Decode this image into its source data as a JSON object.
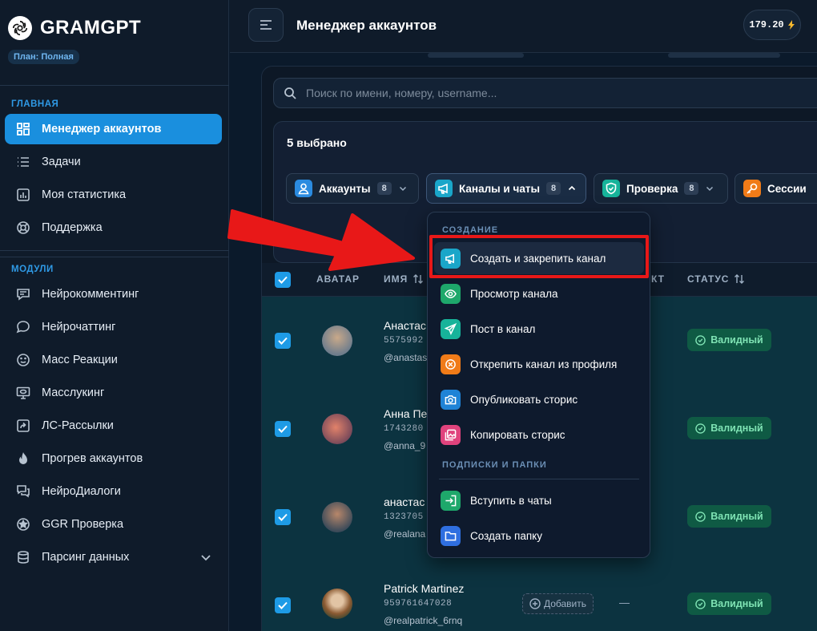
{
  "brand": {
    "name": "GRAMGPT",
    "plan": "План: Полная"
  },
  "sidebar": {
    "section_main": "ГЛАВНАЯ",
    "section_modules": "МОДУЛИ",
    "main_items": [
      {
        "label": "Менеджер аккаунтов",
        "icon": "grid-icon",
        "active": true
      },
      {
        "label": "Задачи",
        "icon": "list-icon"
      },
      {
        "label": "Моя статистика",
        "icon": "chart-icon"
      },
      {
        "label": "Поддержка",
        "icon": "lifebuoy-icon"
      }
    ],
    "module_items": [
      {
        "label": "Нейрокомментинг",
        "icon": "comment-icon"
      },
      {
        "label": "Нейрочаттинг",
        "icon": "chat-bubble-icon"
      },
      {
        "label": "Масс Реакции",
        "icon": "smile-icon"
      },
      {
        "label": "Масслукинг",
        "icon": "monitor-eye-icon"
      },
      {
        "label": "ЛС-Рассылки",
        "icon": "forward-icon"
      },
      {
        "label": "Прогрев аккаунтов",
        "icon": "flame-icon"
      },
      {
        "label": "НейроДиалоги",
        "icon": "dialogs-icon"
      },
      {
        "label": "GGR Проверка",
        "icon": "star-badge-icon"
      },
      {
        "label": "Парсинг данных",
        "icon": "database-icon"
      }
    ]
  },
  "header": {
    "title": "Менеджер аккаунтов",
    "balance": "179.20"
  },
  "search": {
    "placeholder": "Поиск по имени, номеру, username..."
  },
  "selection": {
    "count": "5",
    "label": "выбрано"
  },
  "chips": [
    {
      "label": "Аккаунты",
      "count": "8",
      "icon": "user-icon",
      "color": "#2b8be0"
    },
    {
      "label": "Каналы и чаты",
      "count": "8",
      "icon": "megaphone-icon",
      "color": "#1aa6c9"
    },
    {
      "label": "Проверка",
      "count": "8",
      "icon": "shield-check-icon",
      "color": "#17b39a"
    },
    {
      "label": "Сессии",
      "count": "",
      "icon": "key-icon",
      "color": "#f07b18"
    }
  ],
  "table": {
    "headers": {
      "avatar": "АВАТАР",
      "name": "ИМЯ",
      "contact": "КТ",
      "status": "СТАТУС"
    },
    "rows": [
      {
        "name": "Анастас",
        "phone": "5575992",
        "username": "@anastas",
        "status": "Валидный"
      },
      {
        "name": "Анна Пе",
        "phone": "1743280",
        "username": "@anna_9",
        "status": "Валидный"
      },
      {
        "name": "анастас",
        "phone": "1323705",
        "username": "@realana",
        "status": "Валидный"
      },
      {
        "name": "Patrick Martinez",
        "phone": "959761647028",
        "username": "@realpatrick_6rnq",
        "status": "Валидный",
        "add_label": "Добавить",
        "contact": "—"
      }
    ]
  },
  "dropdown": {
    "section_create": "СОЗДАНИЕ",
    "section_subs": "ПОДПИСКИ И ПАПКИ",
    "items": [
      {
        "label": "Создать и закрепить канал",
        "icon": "megaphone-icon",
        "color": "#1aa6c9"
      },
      {
        "label": "Просмотр канала",
        "icon": "eye-icon",
        "color": "#1ea86b"
      },
      {
        "label": "Пост в канал",
        "icon": "send-icon",
        "color": "#17b39a"
      },
      {
        "label": "Открепить канал из профиля",
        "icon": "unpin-icon",
        "color": "#f07b18"
      },
      {
        "label": "Опубликовать сторис",
        "icon": "camera-icon",
        "color": "#1f83d6"
      },
      {
        "label": "Копировать сторис",
        "icon": "image-copy-icon",
        "color": "#e0437d"
      },
      {
        "label": "Вступить в чаты",
        "icon": "join-icon",
        "color": "#1ea86b"
      },
      {
        "label": "Создать папку",
        "icon": "folder-icon",
        "color": "#2f6fe0"
      }
    ]
  }
}
